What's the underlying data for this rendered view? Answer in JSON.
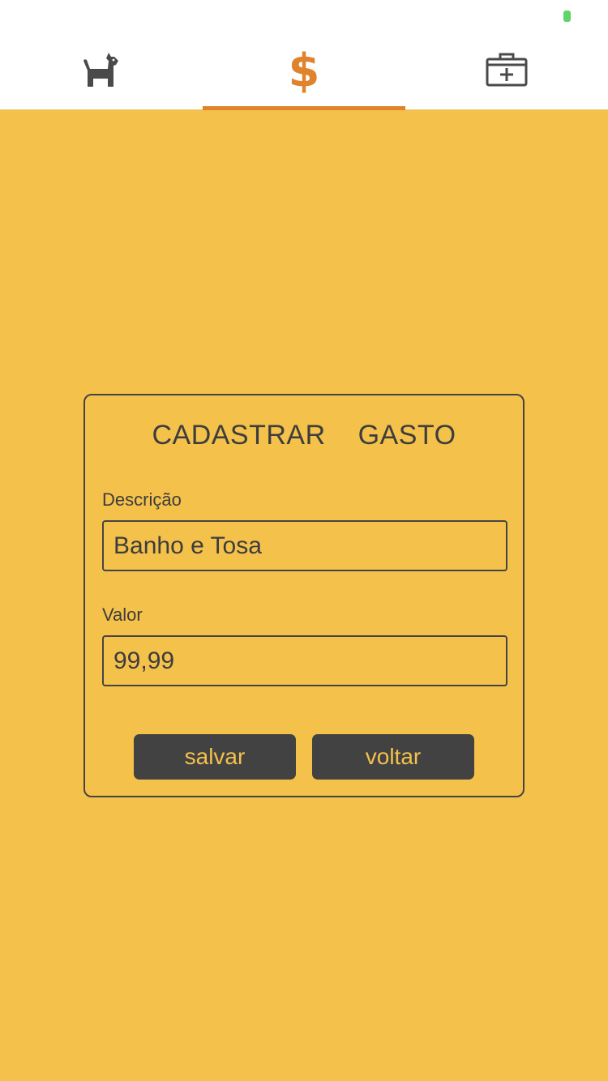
{
  "tabs": [
    {
      "icon": "dog-icon",
      "active": false
    },
    {
      "icon": "dollar-icon",
      "glyph": "$",
      "active": true
    },
    {
      "icon": "medical-kit-icon",
      "active": false
    }
  ],
  "colors": {
    "background": "#F4C14B",
    "accent": "#E0832C",
    "dark": "#424242",
    "tabbar": "#FFFFFF"
  },
  "form": {
    "title": "CADASTRAR GASTO",
    "description_label": "Descrição",
    "description_value": "Banho e Tosa",
    "value_label": "Valor",
    "value_value": "99,99",
    "save_label": "salvar",
    "back_label": "voltar"
  }
}
